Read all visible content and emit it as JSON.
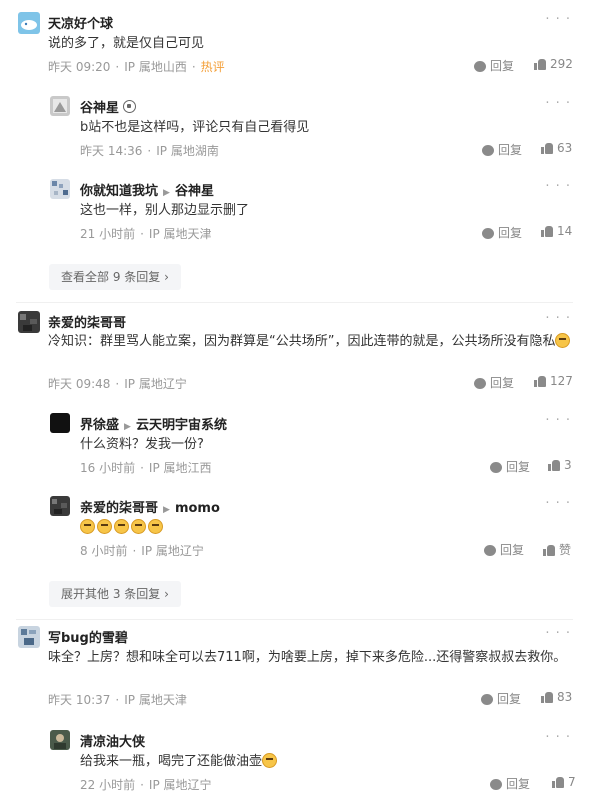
{
  "ui": {
    "more": "· · ·",
    "reply_label": "回复"
  },
  "c1": {
    "name": "天凉好个球",
    "text": "说的多了，就是仅自己可见",
    "time": "昨天 09:20",
    "ip": "IP 属地山西",
    "tag": "热评",
    "likes": "292"
  },
  "r1": {
    "name": "谷神星",
    "text": "b站不也是这样吗，评论只有自己看得见",
    "time": "昨天 14:36",
    "ip": "IP 属地湖南",
    "likes": "63"
  },
  "r2": {
    "name": "你就知道我坑",
    "to": "谷神星",
    "text": "这也一样，别人那边显示删了",
    "time": "21 小时前",
    "ip": "IP 属地天津",
    "likes": "14"
  },
  "expand1": "查看全部 9 条回复 ›",
  "c2": {
    "name": "亲爱的柒哥哥",
    "text": "冷知识：群里骂人能立案，因为群算是“公共场所”，因此连带的就是，公共场所没有隐私",
    "time": "昨天 09:48",
    "ip": "IP 属地辽宁",
    "likes": "127"
  },
  "r3": {
    "name": "界徐盛",
    "to": "云天明宇宙系统",
    "text": "什么资料？发我一份?",
    "time": "16 小时前",
    "ip": "IP 属地江西",
    "likes": "3"
  },
  "r4": {
    "name": "亲爱的柒哥哥",
    "to": "momo",
    "time": "8 小时前",
    "ip": "IP 属地辽宁",
    "likes": "赞"
  },
  "expand2": "展开其他 3 条回复 ›",
  "c3": {
    "name": "写bug的雪碧",
    "text": "味全？上房？想和味全可以去711啊，为啥要上房，掉下来多危险...还得警察叔叔去救你。",
    "time": "昨天 10:37",
    "ip": "IP 属地天津",
    "likes": "83"
  },
  "r5": {
    "name": "清凉油大侠",
    "text": "给我来一瓶，喝完了还能做油壶",
    "time": "22 小时前",
    "ip": "IP 属地辽宁",
    "likes": "7"
  },
  "colors": {
    "hot": "#f4a03a",
    "meta": "#999999",
    "expand_bg": "#f4f5f7"
  }
}
